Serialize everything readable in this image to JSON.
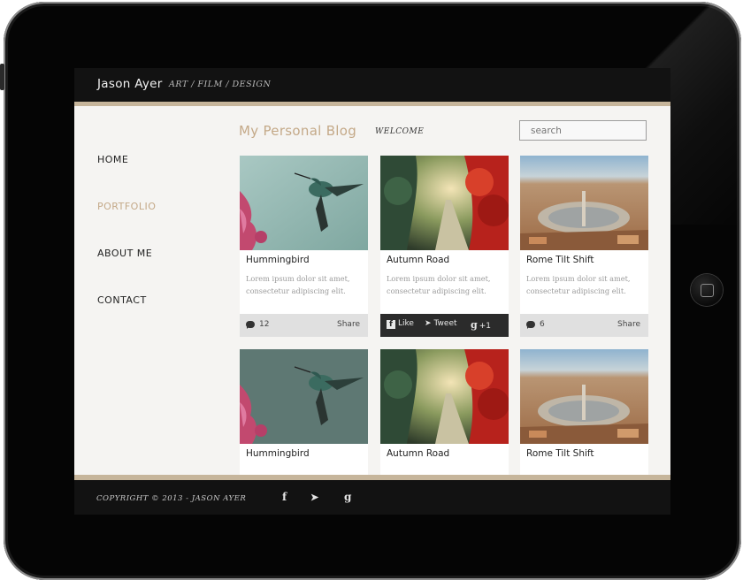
{
  "header": {
    "site_name": "Jason Ayer",
    "tagline": "ART  /  FILM  /  DESIGN"
  },
  "page": {
    "title": "My Personal Blog",
    "welcome": "WELCOME"
  },
  "search": {
    "placeholder": "search"
  },
  "nav": {
    "items": [
      {
        "label": "HOME",
        "active": false
      },
      {
        "label": "PORTFOLIO",
        "active": true
      },
      {
        "label": "ABOUT ME",
        "active": false
      },
      {
        "label": "CONTACT",
        "active": false
      }
    ]
  },
  "cards": [
    {
      "title": "Hummingbird",
      "text": "Lorem ipsum dolor sit amet, consectetur adipiscing elit.",
      "image": "hummingbird-photo",
      "comments": "12",
      "share": "Share"
    },
    {
      "title": "Autumn Road",
      "text": "Lorem ipsum dolor sit amet, consectetur adipiscing elit.",
      "image": "autumn-road-photo",
      "like": "Like",
      "tweet": "Tweet",
      "plus": "+1"
    },
    {
      "title": "Rome Tilt Shift",
      "text": "Lorem ipsum dolor sit amet, consectetur adipiscing elit.",
      "image": "rome-tilt-shift-photo",
      "comments": "6",
      "share": "Share"
    },
    {
      "title": "Hummingbird",
      "image": "hummingbird-photo"
    },
    {
      "title": "Autumn Road",
      "image": "autumn-road-photo"
    },
    {
      "title": "Rome Tilt Shift",
      "image": "rome-tilt-shift-photo"
    }
  ],
  "footer": {
    "copyright": "COPYRIGHT ©  2013 - JASON AYER",
    "social_icons": [
      "facebook-icon",
      "twitter-icon",
      "google-plus-icon"
    ]
  },
  "colors": {
    "accent": "#c4a988",
    "bar": "#121212",
    "stripe": "#c6b59b",
    "background": "#f5f4f2"
  }
}
